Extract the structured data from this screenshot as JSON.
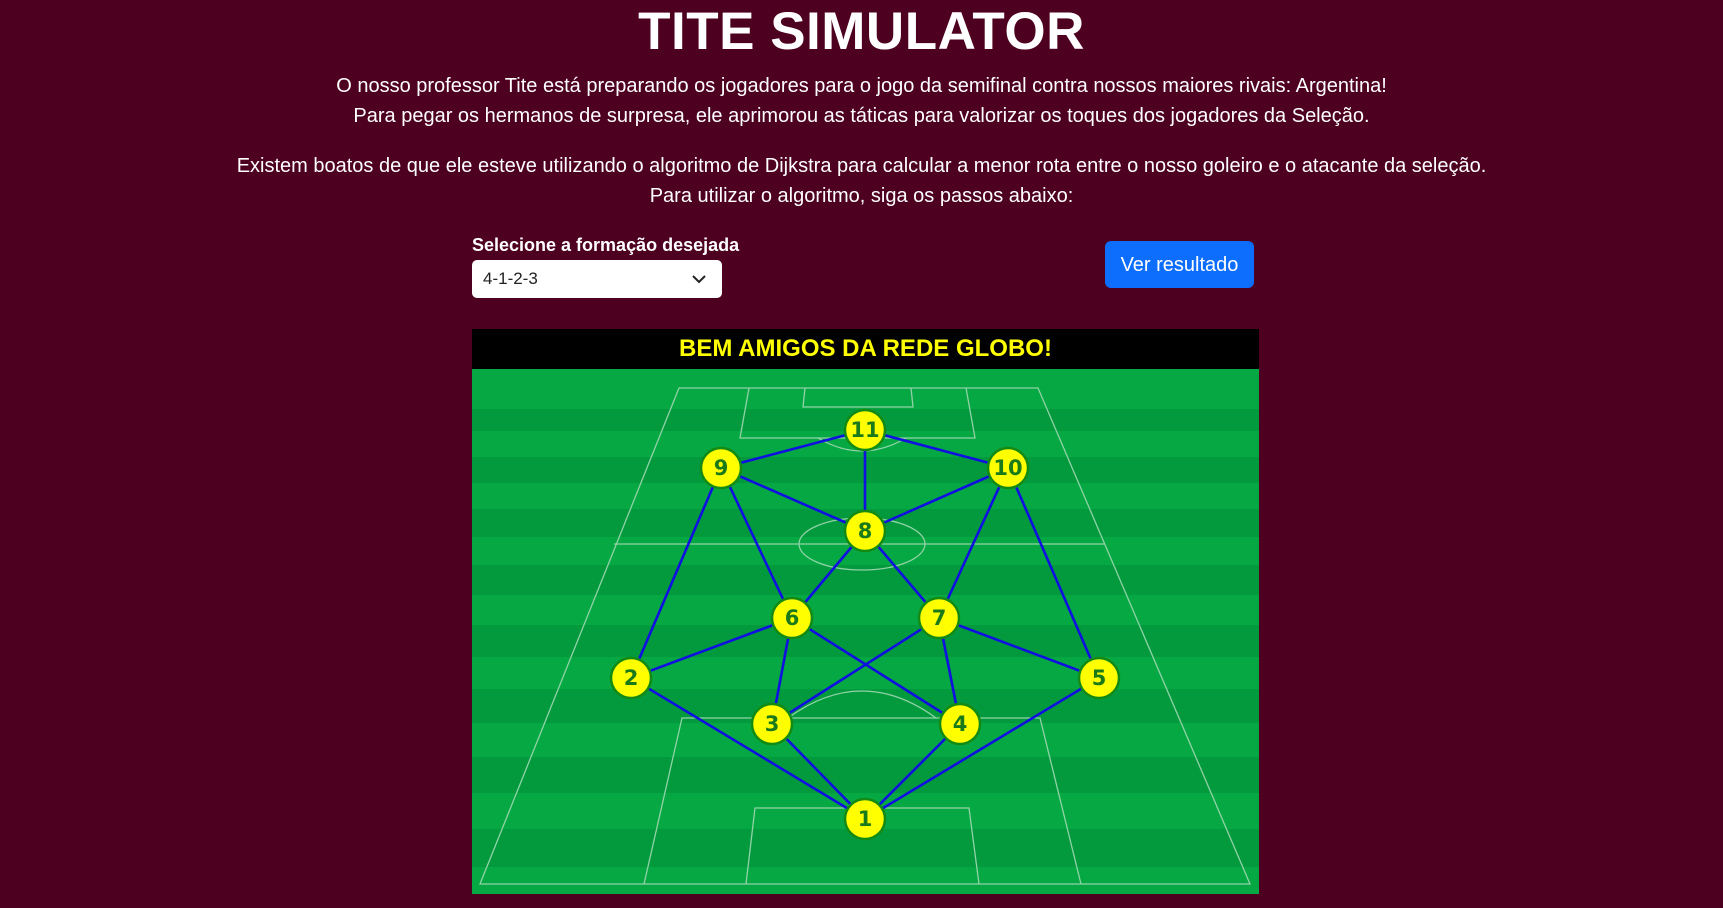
{
  "page": {
    "title": "TITE SIMULATOR",
    "intro_line_1": "O nosso professor Tite está preparando os jogadores para o jogo da semifinal contra nossos maiores rivais: Argentina!",
    "intro_line_2": "Para pegar os hermanos de surpresa, ele aprimorou as táticas para valorizar os toques dos jogadores da Seleção.",
    "intro_line_3": "Existem boatos de que ele esteve utilizando o algoritmo de Dijkstra para calcular a menor rota entre o nosso goleiro e o atacante da seleção.",
    "intro_line_4": "Para utilizar o algoritmo, siga os passos abaixo:"
  },
  "controls": {
    "formation_label": "Selecione a formação desejada",
    "formation_value": "4-1-2-3",
    "result_button_label": "Ver resultado"
  },
  "field": {
    "header": "BEM AMIGOS DA REDE GLOBO!",
    "nodes": [
      {
        "label": "1"
      },
      {
        "label": "2"
      },
      {
        "label": "3"
      },
      {
        "label": "4"
      },
      {
        "label": "5"
      },
      {
        "label": "6"
      },
      {
        "label": "7"
      },
      {
        "label": "8"
      },
      {
        "label": "9"
      },
      {
        "label": "10"
      },
      {
        "label": "11"
      }
    ],
    "edges": [
      [
        "1",
        "2"
      ],
      [
        "1",
        "3"
      ],
      [
        "1",
        "4"
      ],
      [
        "1",
        "5"
      ],
      [
        "2",
        "6"
      ],
      [
        "2",
        "9"
      ],
      [
        "3",
        "6"
      ],
      [
        "3",
        "7"
      ],
      [
        "4",
        "6"
      ],
      [
        "4",
        "7"
      ],
      [
        "5",
        "7"
      ],
      [
        "5",
        "10"
      ],
      [
        "6",
        "8"
      ],
      [
        "6",
        "9"
      ],
      [
        "7",
        "8"
      ],
      [
        "7",
        "10"
      ],
      [
        "8",
        "9"
      ],
      [
        "8",
        "10"
      ],
      [
        "8",
        "11"
      ],
      [
        "9",
        "11"
      ],
      [
        "10",
        "11"
      ]
    ],
    "colors": {
      "grass_dark": "#039a3e",
      "grass_light": "#06a843",
      "line": "#8fd3a6",
      "edge": "#1010e0",
      "node_fill": "#ffff00",
      "node_stroke": "#138a13",
      "header_bg": "#000000",
      "header_text": "#ffff00"
    }
  }
}
